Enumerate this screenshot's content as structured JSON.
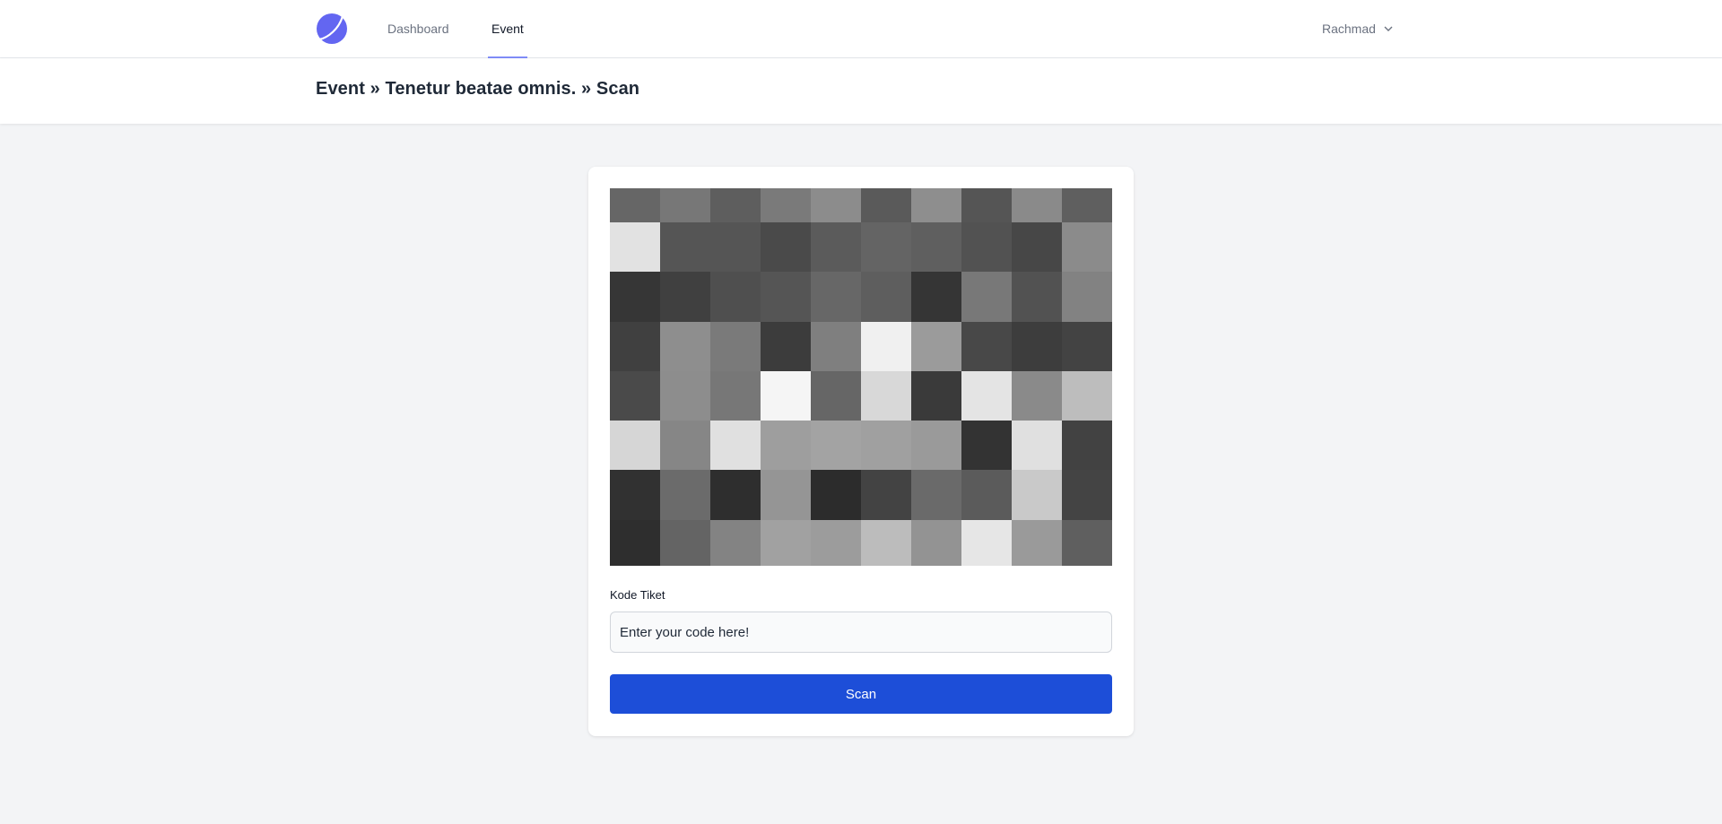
{
  "nav": {
    "logo_icon": "app-logo-icon",
    "links": [
      {
        "label": "Dashboard",
        "active": false
      },
      {
        "label": "Event",
        "active": true
      }
    ],
    "user": {
      "name": "Rachmad",
      "icon": "chevron-down-icon"
    }
  },
  "header": {
    "title": "Event » Tenetur beatae omnis. » Scan"
  },
  "scan_form": {
    "camera_preview": "camera-preview",
    "field_label": "Kode Tiket",
    "input_placeholder": "Enter your code here!",
    "input_value": "",
    "submit_label": "Scan"
  },
  "colors": {
    "accent": "#818cf8",
    "button": "#1d4ed8",
    "background": "#f3f4f6"
  }
}
